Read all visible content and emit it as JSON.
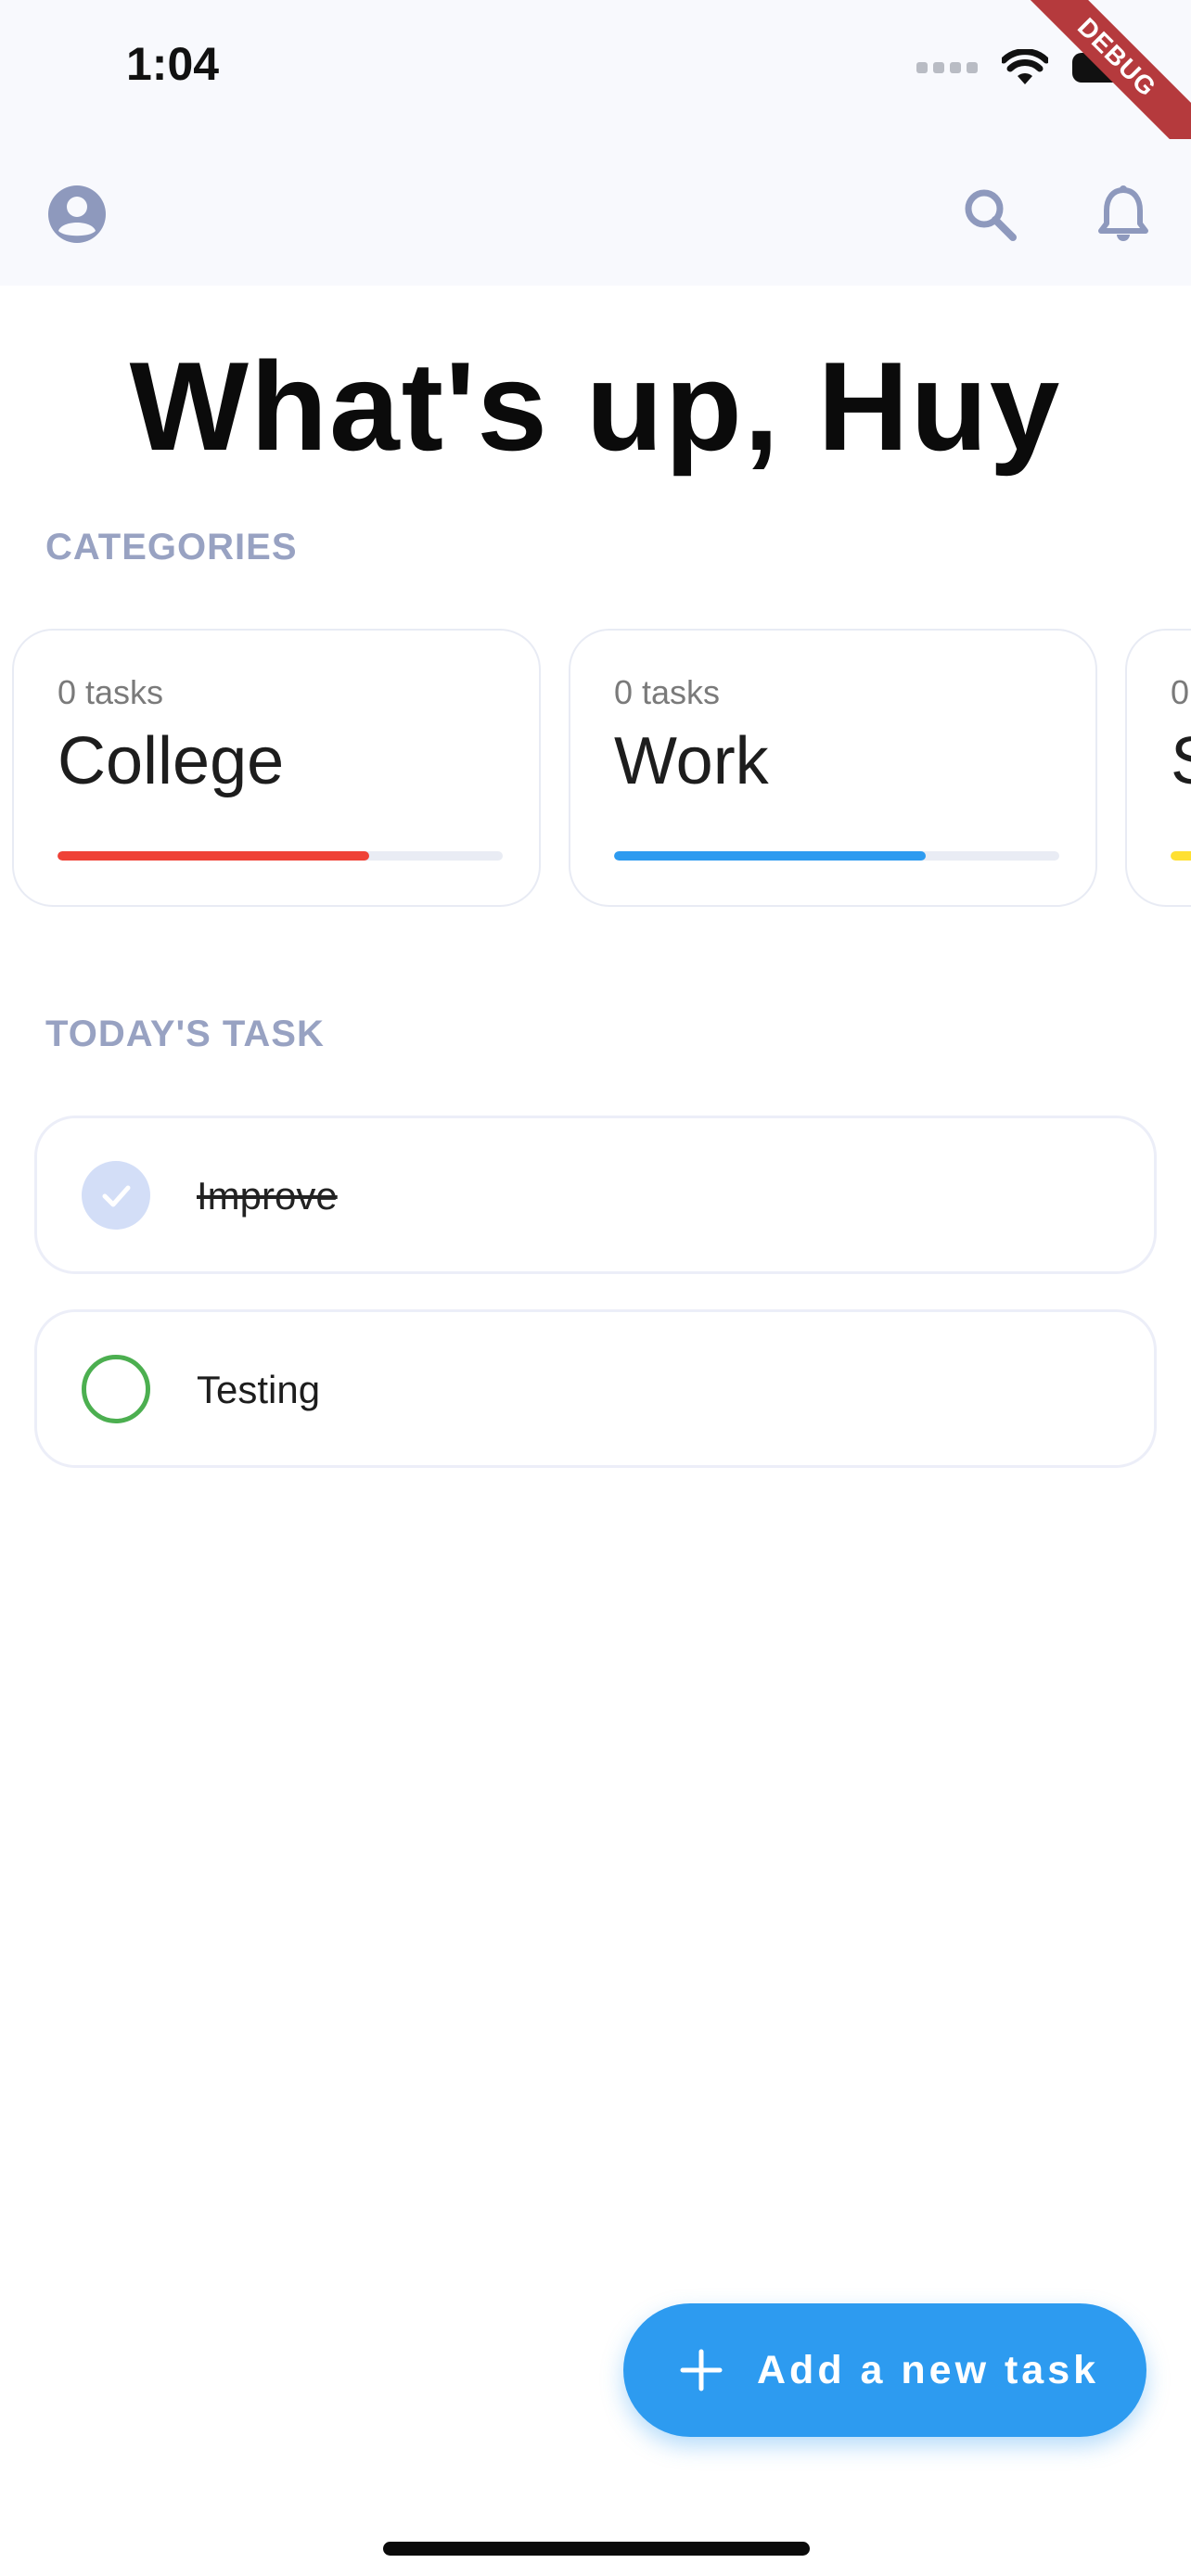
{
  "status_bar": {
    "time": "1:04",
    "debug_label": "DEBUG"
  },
  "app_bar": {
    "icons": [
      "account-circle-icon",
      "search-icon",
      "bell-icon"
    ],
    "icon_color": "#8e99bd"
  },
  "greeting": "What's up, Huy",
  "categories": {
    "label": "CATEGORIES",
    "items": [
      {
        "count": "0 tasks",
        "name": "College",
        "progress": 0.7,
        "color": "#ef4136"
      },
      {
        "count": "0 tasks",
        "name": "Work",
        "progress": 0.7,
        "color": "#2d9bf0"
      },
      {
        "count": "0",
        "name": "S",
        "progress": 0.5,
        "color": "#ffe032"
      }
    ]
  },
  "today": {
    "label": "TODAY'S TASK",
    "tasks": [
      {
        "title": "Improve",
        "done": true,
        "check_color": "#d3def7"
      },
      {
        "title": "Testing",
        "done": false,
        "check_color": "#4caf50"
      }
    ]
  },
  "fab": {
    "label": "Add a new task",
    "color": "#2d9bf0"
  }
}
